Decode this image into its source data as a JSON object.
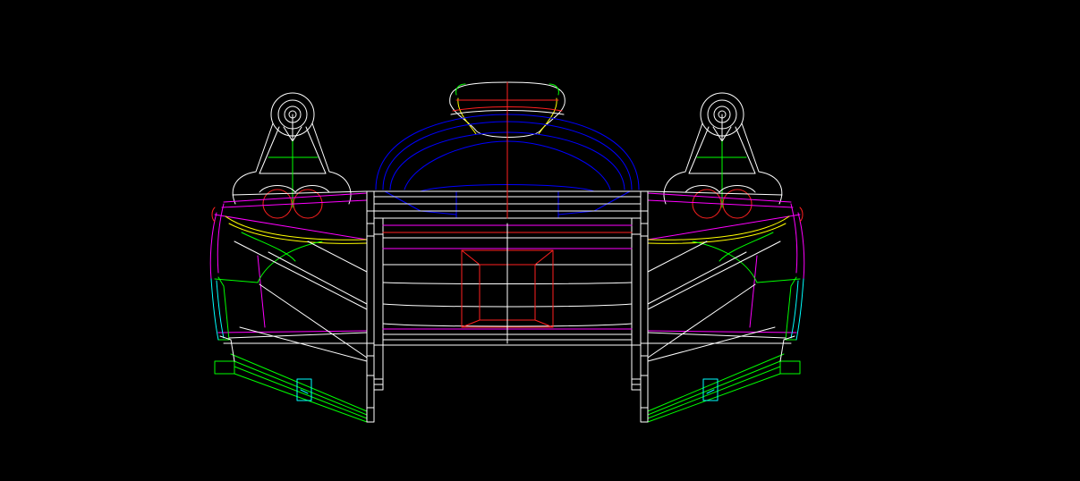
{
  "viewport": {
    "background": "#000000"
  },
  "layer_colors": {
    "outline": "#ffffff",
    "centerline": "#ff2020",
    "body": "#ff00ff",
    "detail": "#00ff00",
    "canopy": "#0000ff",
    "cyan_detail": "#00ffff",
    "yellow_detail": "#ffff00"
  }
}
